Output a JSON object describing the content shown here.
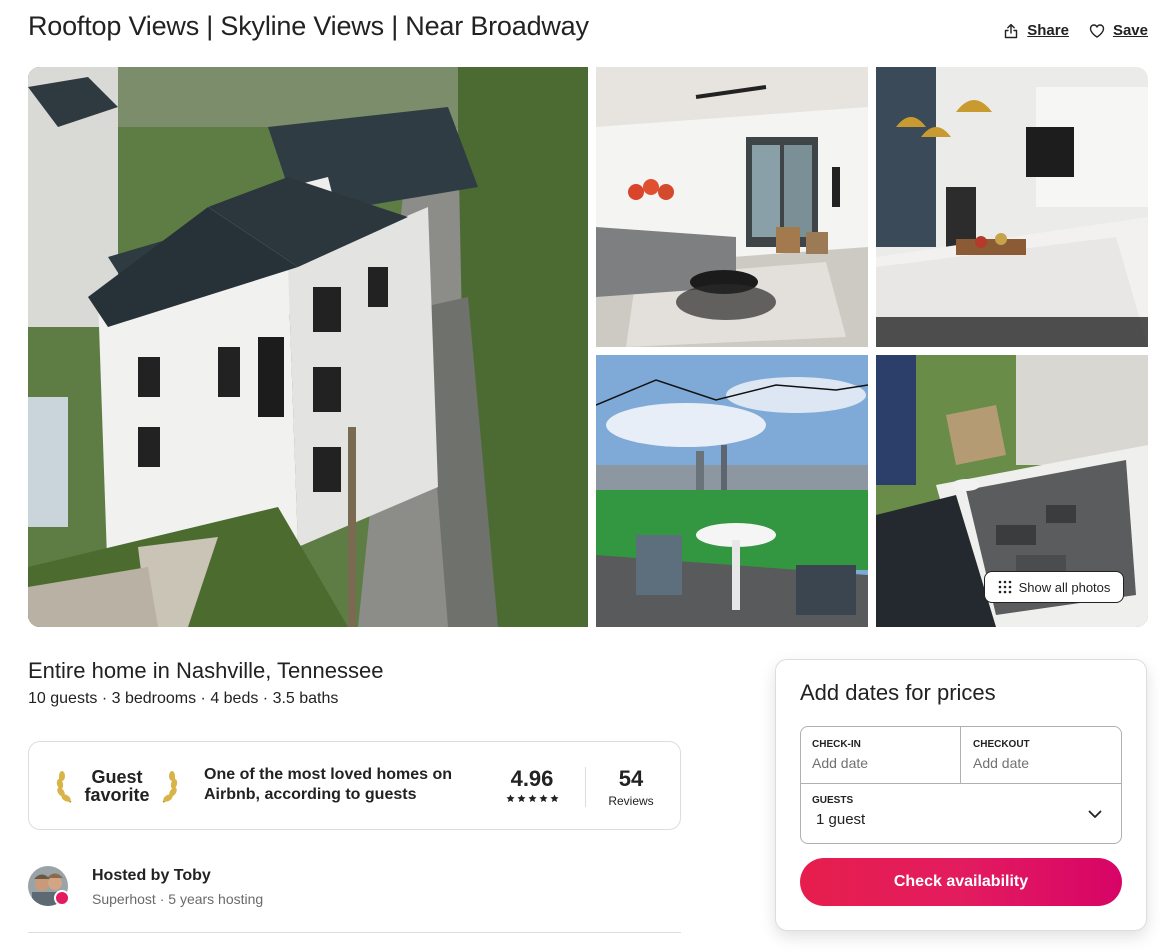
{
  "header": {
    "title": "Rooftop Views | Skyline Views | Near Broadway",
    "share_label": "Share",
    "save_label": "Save"
  },
  "gallery": {
    "show_all_label": "Show all photos"
  },
  "listing": {
    "subtitle": "Entire home in Nashville, Tennessee",
    "overview": "10 guests · 3 bedrooms · 4 beds · 3.5 baths"
  },
  "guest_favorite": {
    "badge_line1": "Guest",
    "badge_line2": "favorite",
    "description": "One of the most loved homes on Airbnb, according to guests",
    "rating": "4.96",
    "stars": 5,
    "reviews_count": "54",
    "reviews_label": "Reviews"
  },
  "host": {
    "name": "Hosted by Toby",
    "details": "Superhost · 5 years hosting"
  },
  "booking": {
    "title": "Add dates for prices",
    "checkin_label": "CHECK-IN",
    "checkin_value": "Add date",
    "checkout_label": "CHECKOUT",
    "checkout_value": "Add date",
    "guests_label": "GUESTS",
    "guests_value": "1 guest",
    "button_label": "Check availability"
  },
  "colors": {
    "brand": "#e31c5f",
    "text": "#222222",
    "muted": "#6a6a6a",
    "border": "#dddddd"
  }
}
